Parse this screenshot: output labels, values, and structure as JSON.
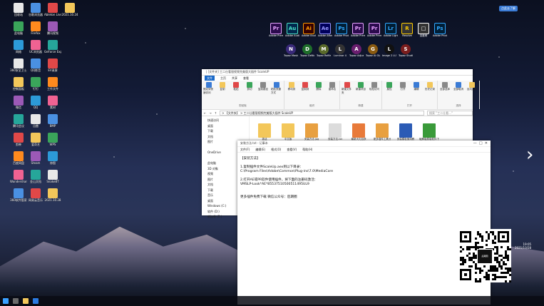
{
  "desktop": {
    "left_column_labels": [
      "Nev",
      "",
      "",
      "light",
      "",
      "",
      "",
      "",
      "Sc",
      "",
      "",
      "",
      "",
      "",
      "",
      "",
      "",
      "",
      ""
    ],
    "icons": [
      {
        "label": "回收站"
      },
      {
        "label": "谷歌浏览器"
      },
      {
        "label": "Ableton Live"
      },
      {
        "label": "2021.10.24"
      },
      {
        "label": "此电脑"
      },
      {
        "label": "Firefox"
      },
      {
        "label": "腾讯视频"
      },
      {
        "label": "网络"
      },
      {
        "label": "UC浏览器"
      },
      {
        "label": "GeForce Experience"
      },
      {
        "label": "360安全卫士"
      },
      {
        "label": "QQ影音"
      },
      {
        "label": "EV录屏"
      },
      {
        "label": "控制面板"
      },
      {
        "label": "钉钉"
      },
      {
        "label": "工作文件"
      },
      {
        "label": "微信"
      },
      {
        "label": "QQ"
      },
      {
        "label": "素材"
      },
      {
        "label": "腾讯会议"
      },
      {
        "label": "迅雷"
      },
      {
        "label": "BMP"
      },
      {
        "label": "剪映"
      },
      {
        "label": "爱奇艺"
      },
      {
        "label": "WPS"
      },
      {
        "label": "百度网盘"
      },
      {
        "label": "Steam"
      },
      {
        "label": "修图"
      },
      {
        "label": "Wondershare"
      },
      {
        "label": "金山文档"
      },
      {
        "label": "SnakeBT"
      },
      {
        "label": "360软件管家"
      },
      {
        "label": "网易云音乐"
      },
      {
        "label": "2021.10.28"
      }
    ],
    "adobe_apps": [
      {
        "abbr": "Pr",
        "label": "Adobe Premie...",
        "color": "#2c0b4d",
        "fg": "#e7a2ff"
      },
      {
        "abbr": "Au",
        "label": "Adobe Audition",
        "color": "#00284d",
        "fg": "#4ce3c7"
      },
      {
        "abbr": "Ai",
        "label": "Adobe Illustrat...",
        "color": "#330000",
        "fg": "#ff9a00"
      },
      {
        "abbr": "Ae",
        "label": "Adobe After Effects CC",
        "color": "#00005b",
        "fg": "#9999ff"
      },
      {
        "abbr": "Ps",
        "label": "Adobe Photosh...",
        "color": "#001e36",
        "fg": "#31a8ff"
      },
      {
        "abbr": "Pr",
        "label": "Adobe Premie...",
        "color": "#2c0b4d",
        "fg": "#e7a2ff"
      },
      {
        "abbr": "Pr",
        "label": "Adobe Premie...",
        "color": "#2c0b4d",
        "fg": "#e7a2ff"
      },
      {
        "abbr": "Lr",
        "label": "Adobe Lightroo...",
        "color": "#001d34",
        "fg": "#31a8ff"
      },
      {
        "abbr": "R",
        "label": "Resolve",
        "color": "#333",
        "fg": "#ffcc00"
      },
      {
        "abbr": "□",
        "label": "百度网",
        "color": "#333",
        "fg": "#fff"
      },
      {
        "abbr": "Ps",
        "label": "Adobe Photosh...",
        "color": "#001e36",
        "fg": "#31a8ff"
      }
    ],
    "topaz_apps": [
      {
        "abbr": "N",
        "label": "Topaz Mask AI",
        "color": "#3a2a7a"
      },
      {
        "abbr": "D",
        "label": "Topaz DeNoise AI",
        "color": "#1e6e2a"
      },
      {
        "abbr": "M",
        "label": "Topaz ReMask",
        "color": "#5a6a2a"
      },
      {
        "abbr": "L",
        "label": "Luminar 4",
        "color": "#333"
      },
      {
        "abbr": "A",
        "label": "Topaz Adjust AI",
        "color": "#6a1e6e"
      },
      {
        "abbr": "G",
        "label": "Topaz AI Gigapixel",
        "color": "#8a5a10"
      },
      {
        "abbr": "L",
        "label": "Image 2 LUT",
        "color": "#111"
      },
      {
        "abbr": "S",
        "label": "Topaz Studio 2",
        "color": "#7a1e1e"
      }
    ],
    "badge": "点此去了解",
    "clock_time": "19:05",
    "clock_date": "2021/10/28",
    "next_arrow": "›"
  },
  "explorer": {
    "title": "| [文件夹] 工二仕看银视频完美版大插件 ScaleUP",
    "tabs": [
      "文件",
      "主页",
      "共享",
      "查看"
    ],
    "ribbon": {
      "groups": [
        {
          "label": "剪贴板",
          "buttons": [
            "固定到快速访问",
            "复制",
            "粘贴",
            "剪切",
            "复制路径",
            "粘贴快捷方式"
          ]
        },
        {
          "label": "组织",
          "buttons": [
            "移动到",
            "复制到",
            "删除",
            "重命名"
          ]
        },
        {
          "label": "新建",
          "buttons": [
            "新建文件夹",
            "新建项目",
            "轻松访问"
          ]
        },
        {
          "label": "打开",
          "buttons": [
            "属性",
            "打开",
            "编辑",
            "历史记录"
          ]
        },
        {
          "label": "选择",
          "buttons": [
            "全部选择",
            "全部取消",
            "反向选择"
          ]
        }
      ]
    },
    "address": "> 【文件夹】 > 工二仕看银视频完美版大插件 ScaleUP",
    "search_placeholder": "搜索 \"工二仕看...\"",
    "nav": [
      "快速访问",
      "桌面",
      "下载",
      "文档",
      "图片",
      "",
      "OneDrive",
      "",
      "此电脑",
      "3D 对象",
      "视频",
      "图片",
      "文档",
      "下载",
      "音乐",
      "桌面",
      "Windows (C:)",
      "软件 (D:)",
      "新加卷 (E:)"
    ],
    "files": [
      {
        "label": "激活",
        "color": "#f3c75a"
      },
      {
        "label": "中文版",
        "color": "#f3c75a"
      },
      {
        "label": "安装方法.jpg",
        "color": "#e8a040"
      },
      {
        "label": "安装方法.txt",
        "color": "#dcdcdc"
      },
      {
        "label": "最新大礼包获取.jpg",
        "color": "#e87a3a"
      },
      {
        "label": "更多插件工具分享.jpg",
        "color": "#e8a040"
      },
      {
        "label": "安装模板使用教程.doc",
        "color": "#2b5bb5"
      },
      {
        "label": "破解版原版软件下载",
        "color": "#3a9a3a"
      }
    ],
    "status": "8 个项目"
  },
  "notepad": {
    "title": "安装方法.txt - 记事本",
    "menu": [
      "文件(F)",
      "编辑(E)",
      "格式(O)",
      "查看(V)",
      "帮助(H)"
    ],
    "lines": [
      "【安装方法】",
      "",
      "1.复制插件文件ScaleUp.aex到以下目录：",
      "C:\\Program Files\\Adobe\\Common\\Plug-ins\\7.0\\MediaCore",
      "",
      "2.打开AE或PR软件使用插件，将下面的注册码激活：",
      "VMSLP-Look*AE*85537510500511495UL9",
      "",
      "",
      "更多插件免费下载 微信公众号：后期圈"
    ]
  },
  "qr": {
    "label": "后期圈"
  },
  "colors": {
    "explorer_accent": "#1b6ac9",
    "taskbar": "#0a0c14"
  }
}
